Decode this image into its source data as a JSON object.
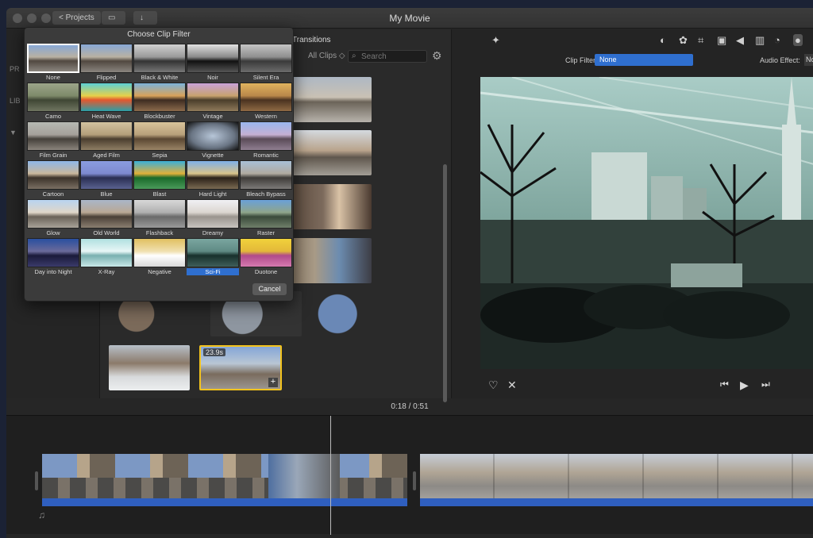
{
  "window": {
    "title": "My Movie",
    "projects_button": "< Projects"
  },
  "browser": {
    "tab_transitions": "Transitions",
    "all_clips": "All Clips",
    "search_placeholder": "Search",
    "sidebar_fragments": [
      "PR",
      "LIB"
    ],
    "selected_clip_duration": "23.9s"
  },
  "viewer": {
    "clip_filter_label": "Clip Filter:",
    "clip_filter_value": "None",
    "audio_effect_label": "Audio Effect:",
    "audio_effect_value": "No"
  },
  "timeline": {
    "current_time": "0:18",
    "separator": "/",
    "total_time": "0:51"
  },
  "dialog": {
    "title": "Choose Clip Filter",
    "cancel_label": "Cancel",
    "filters": [
      "None",
      "Flipped",
      "Black & White",
      "Noir",
      "Silent Era",
      "Camo",
      "Heat Wave",
      "Blockbuster",
      "Vintage",
      "Western",
      "Film Grain",
      "Aged Film",
      "Sepia",
      "Vignette",
      "Romantic",
      "Cartoon",
      "Blue",
      "Blast",
      "Hard Light",
      "Bleach Bypass",
      "Glow",
      "Old World",
      "Flashback",
      "Dreamy",
      "Raster",
      "Day into Night",
      "X-Ray",
      "Negative",
      "Sci-Fi",
      "Duotone"
    ],
    "selected_filter": "None",
    "highlighted_filter": "Sci-Fi"
  }
}
